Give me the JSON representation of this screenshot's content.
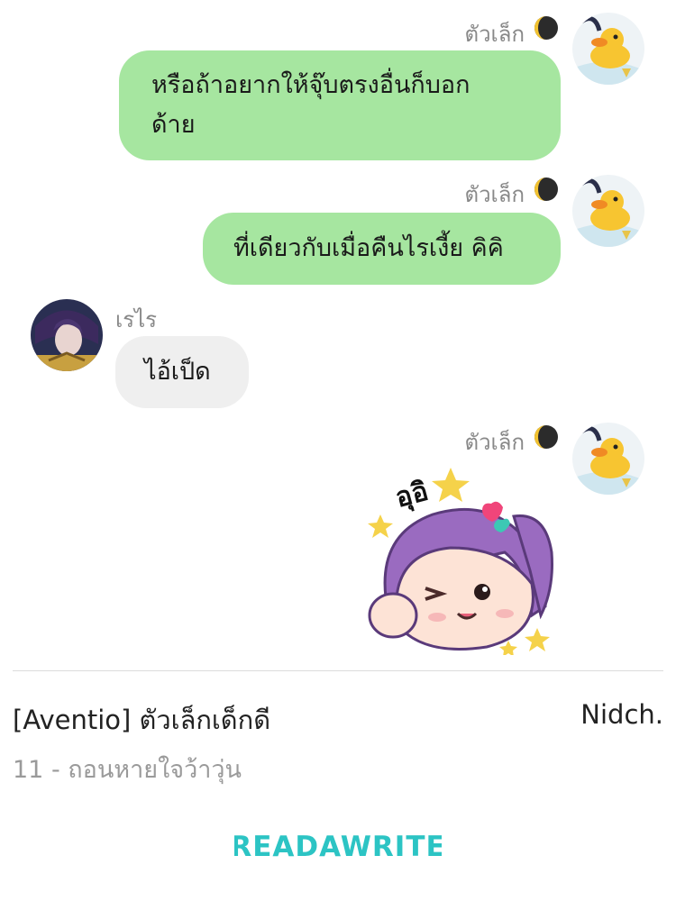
{
  "messages": [
    {
      "sender": "ตัวเล็ก",
      "text_line1": "หรือถ้าอยากให้จุ๊บตรงอื่นก็บอก",
      "text_line2": "ด้าย"
    },
    {
      "sender": "ตัวเล็ก",
      "text": "ที่เดียวกับเมื่อคืนไรเงี้ย คิคิ"
    },
    {
      "sender": "เรไร",
      "text": "ไอ้เป็ด"
    },
    {
      "sender": "ตัวเล็ก",
      "sticker": "sticker-girl-wink-icon",
      "sticker_text": "อุอิ"
    }
  ],
  "footer": {
    "story_title": "[Aventio] ตัวเล็กเด็กดี",
    "author": "Nidch.",
    "chapter": "11 - ถอนหายใจว้าวุ่น"
  },
  "brand": {
    "logo_text": "READAWRITE",
    "color": "#2cc4c4"
  },
  "colors": {
    "outgoing_bubble": "#a6e6a0",
    "incoming_bubble": "#efefef"
  }
}
